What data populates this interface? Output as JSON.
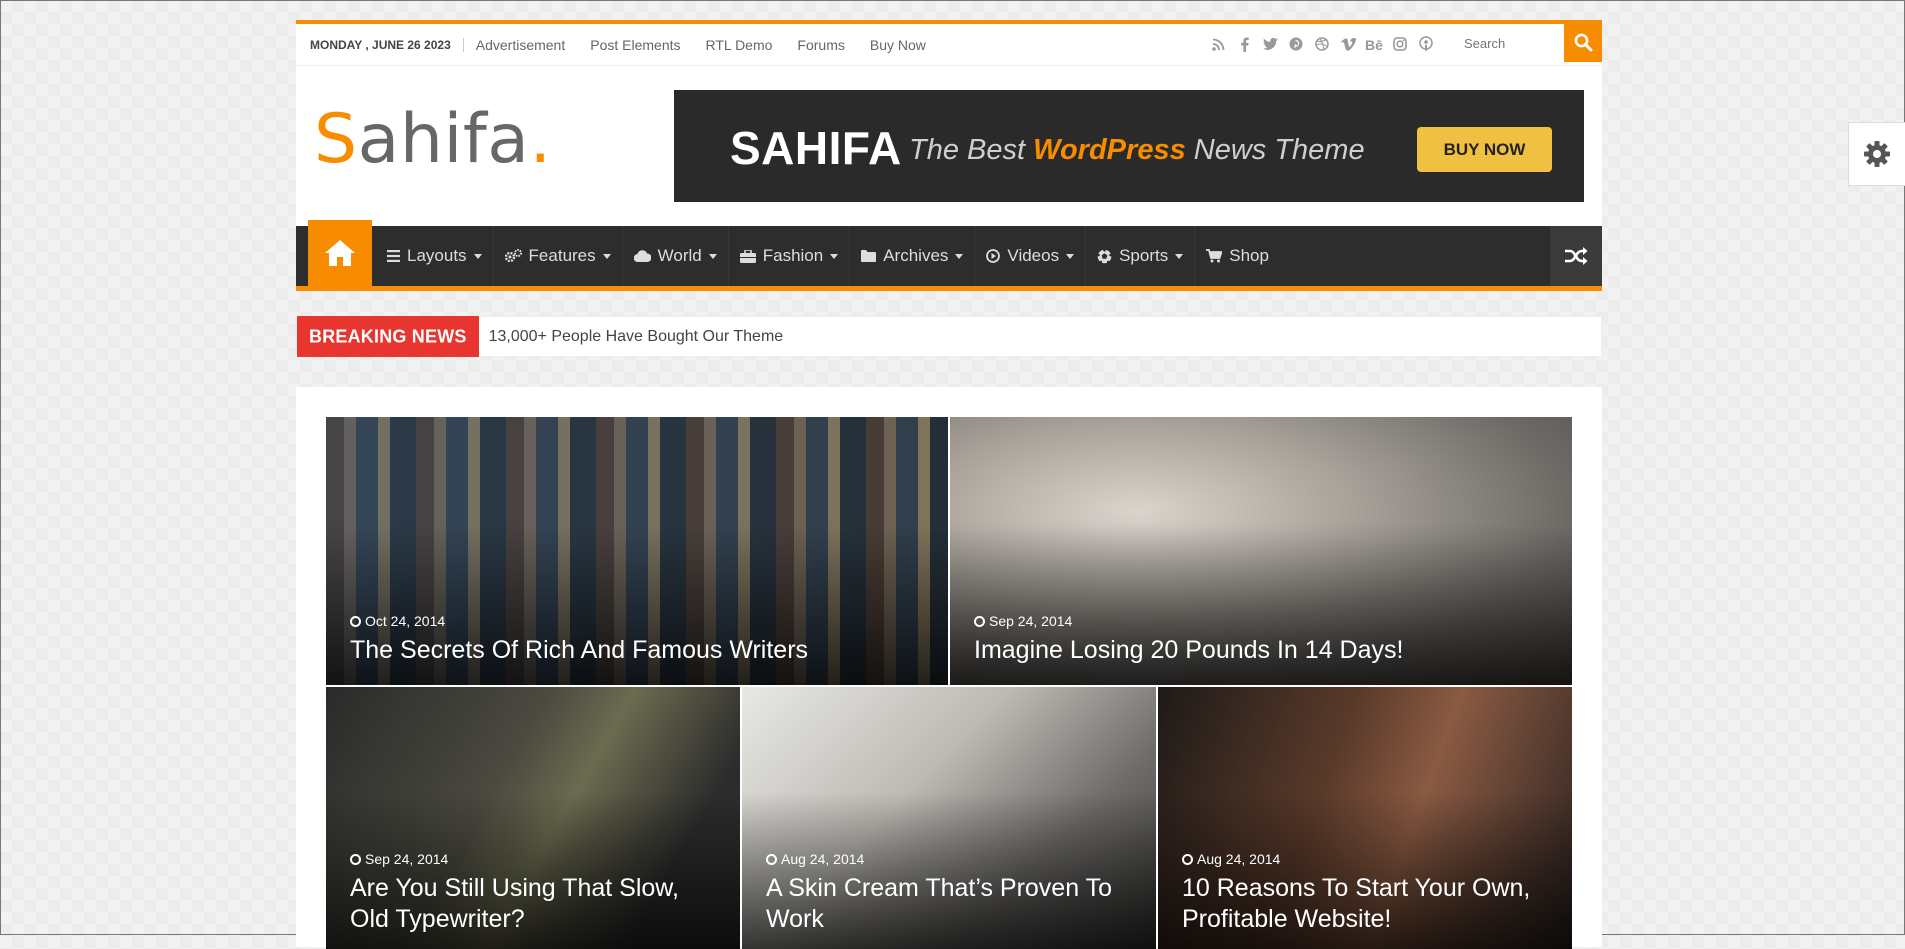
{
  "topbar": {
    "date": "MONDAY , JUNE 26 2023",
    "links": [
      "Advertisement",
      "Post Elements",
      "RTL Demo",
      "Forums",
      "Buy Now"
    ],
    "socials": [
      "rss-icon",
      "facebook-icon",
      "twitter-icon",
      "pinterest-icon",
      "dribbble-icon",
      "vimeo-icon",
      "behance-icon",
      "instagram-icon",
      "podcast-icon"
    ],
    "search_placeholder": "Search"
  },
  "logo": {
    "first": "S",
    "rest": "ahifa",
    "dot": "."
  },
  "banner": {
    "brand": "SAHIFA",
    "tag_before": "The Best ",
    "tag_highlight": "WordPress",
    "tag_after": " News Theme",
    "cta": "BUY NOW"
  },
  "nav": {
    "items": [
      {
        "label": "Layouts",
        "icon": "bars-icon",
        "dropdown": true
      },
      {
        "label": "Features",
        "icon": "gears-icon",
        "dropdown": true
      },
      {
        "label": "World",
        "icon": "cloud-icon",
        "dropdown": true
      },
      {
        "label": "Fashion",
        "icon": "briefcase-icon",
        "dropdown": true
      },
      {
        "label": "Archives",
        "icon": "folder-icon",
        "dropdown": true
      },
      {
        "label": "Videos",
        "icon": "play-circle-icon",
        "dropdown": true
      },
      {
        "label": "Sports",
        "icon": "soccer-ball-icon",
        "dropdown": true
      },
      {
        "label": "Shop",
        "icon": "cart-icon",
        "dropdown": false
      }
    ]
  },
  "breaking": {
    "label": "BREAKING NEWS",
    "text": "13,000+ People Have Bought Our Theme"
  },
  "posts": [
    {
      "date": "Oct 24, 2014",
      "title": "The Secrets Of Rich And Famous Writers"
    },
    {
      "date": "Sep 24, 2014",
      "title": "Imagine Losing 20 Pounds In 14 Days!"
    },
    {
      "date": "Sep 24, 2014",
      "title": "Are You Still Using That Slow, Old Typewriter?"
    },
    {
      "date": "Aug 24, 2014",
      "title": "A Skin Cream That’s Proven To Work"
    },
    {
      "date": "Aug 24, 2014",
      "title": "10 Reasons To Start Your Own, Profitable Website!"
    }
  ],
  "colors": {
    "accent": "#f88c00",
    "nav_bg": "#2d2d2d",
    "breaking": "#e8352f"
  }
}
